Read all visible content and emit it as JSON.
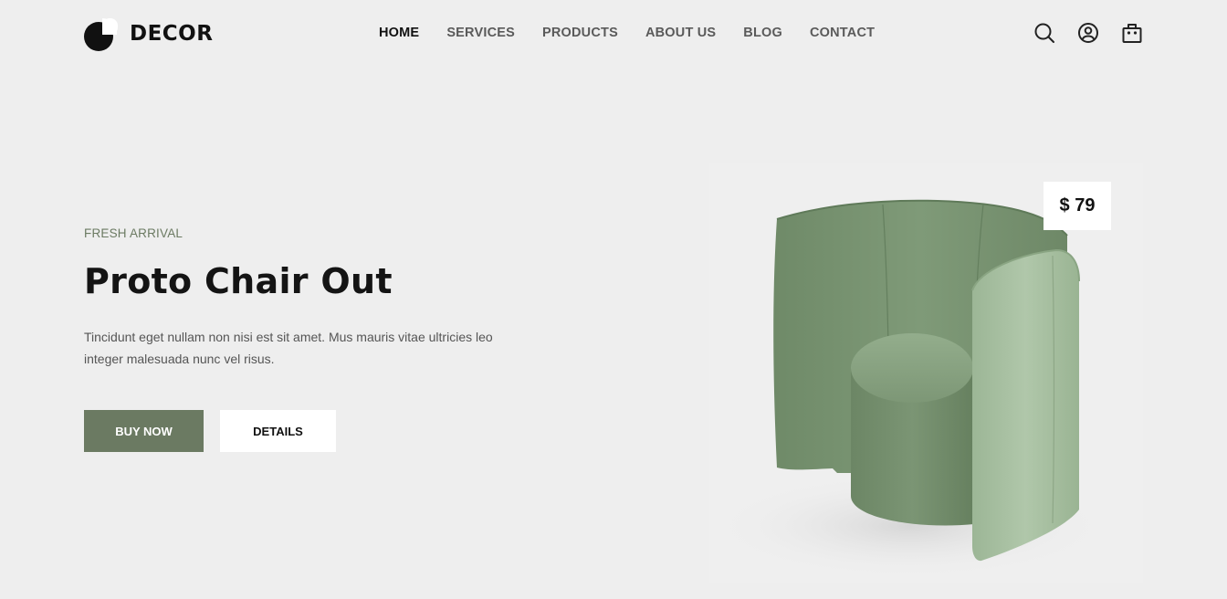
{
  "brand": {
    "name": "DECOR"
  },
  "nav": {
    "items": [
      {
        "label": "HOME"
      },
      {
        "label": "SERVICES"
      },
      {
        "label": "PRODUCTS"
      },
      {
        "label": "ABOUT US"
      },
      {
        "label": "BLOG"
      },
      {
        "label": "CONTACT"
      }
    ],
    "active": "HOME"
  },
  "header_icons": [
    "search-icon",
    "user-icon",
    "bag-icon"
  ],
  "hero": {
    "eyebrow": "FRESH ARRIVAL",
    "title": "Proto Chair Out",
    "description": "Tincidunt eget nullam non nisi est sit amet. Mus mauris vitae ultricies leo integer malesuada nunc vel risus.",
    "buy_label": "BUY NOW",
    "details_label": "DETAILS"
  },
  "product": {
    "price": "$ 79"
  },
  "colors": {
    "accent": "#6b7a62",
    "background": "#eeeeee",
    "chair_green": "#7f9878"
  }
}
